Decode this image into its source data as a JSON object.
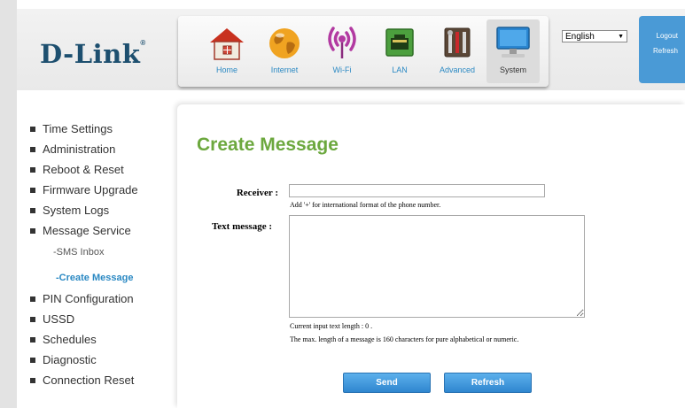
{
  "brand": {
    "logo_text": "D-Link",
    "registered": "®"
  },
  "nav": {
    "items": [
      {
        "label": "Home",
        "icon": "house-icon"
      },
      {
        "label": "Internet",
        "icon": "globe-icon"
      },
      {
        "label": "Wi-Fi",
        "icon": "wifi-icon"
      },
      {
        "label": "LAN",
        "icon": "lan-port-icon"
      },
      {
        "label": "Advanced",
        "icon": "tools-icon"
      },
      {
        "label": "System",
        "icon": "monitor-icon"
      }
    ],
    "active": "System"
  },
  "language": {
    "selected": "English"
  },
  "auth": {
    "logout_label": "Logout",
    "refresh_label": "Refresh"
  },
  "sidebar": {
    "items": [
      {
        "label": "Time Settings"
      },
      {
        "label": "Administration"
      },
      {
        "label": "Reboot & Reset"
      },
      {
        "label": "Firmware Upgrade"
      },
      {
        "label": "System Logs"
      },
      {
        "label": "Message Service"
      },
      {
        "label": "PIN Configuration"
      },
      {
        "label": "USSD"
      },
      {
        "label": "Schedules"
      },
      {
        "label": "Diagnostic"
      },
      {
        "label": "Connection Reset"
      }
    ],
    "sub_items": [
      {
        "label": "-SMS Inbox"
      },
      {
        "label": "-Create Message"
      }
    ]
  },
  "page": {
    "title": "Create Message",
    "receiver_label": "Receiver :",
    "receiver_value": "",
    "receiver_hint": "Add '+' for international format of the phone number.",
    "text_label": "Text message :",
    "text_value": "",
    "length_label": "Current input text length :  0 .",
    "max_length_note": "The max. length of a message is 160 characters for pure alphabetical or numeric.",
    "send_label": "Send",
    "refresh_label": "Refresh"
  },
  "colors": {
    "accent_blue": "#2b89c3",
    "title_green": "#6ca83e",
    "logo_navy": "#1d4f6f",
    "auth_panel": "#4a9ad6"
  }
}
